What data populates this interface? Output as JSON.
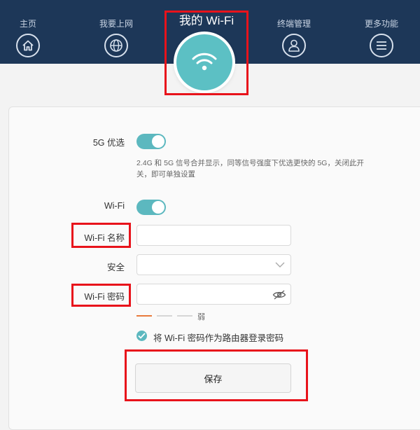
{
  "nav": {
    "items": [
      {
        "label": "主页",
        "icon": "home-icon"
      },
      {
        "label": "我要上网",
        "icon": "globe-icon"
      },
      {
        "label": "终端管理",
        "icon": "user-icon"
      },
      {
        "label": "更多功能",
        "icon": "menu-icon"
      }
    ],
    "active": {
      "label": "我的 Wi-Fi",
      "icon": "wifi-icon"
    }
  },
  "form": {
    "band_pref": {
      "label": "5G 优选",
      "enabled": true,
      "hint": "2.4G 和 5G 信号合并显示，同等信号强度下优选更快的 5G，关闭此开关，即可单独设置"
    },
    "wifi_toggle": {
      "label": "Wi-Fi",
      "enabled": true
    },
    "wifi_name": {
      "label": "Wi-Fi 名称",
      "value": ""
    },
    "security": {
      "label": "安全",
      "value": ""
    },
    "wifi_password": {
      "label": "Wi-Fi 密码",
      "value": ""
    },
    "strength": {
      "text": "弱",
      "level": 1,
      "max": 3
    },
    "use_as_admin": {
      "label": "将 Wi-Fi 密码作为路由器登录密码",
      "checked": true
    },
    "save_label": "保存"
  },
  "colors": {
    "header_bg": "#1d3758",
    "accent": "#5cb8bf",
    "highlight_box": "#e8131b",
    "strength_weak": "#e87a3c"
  }
}
